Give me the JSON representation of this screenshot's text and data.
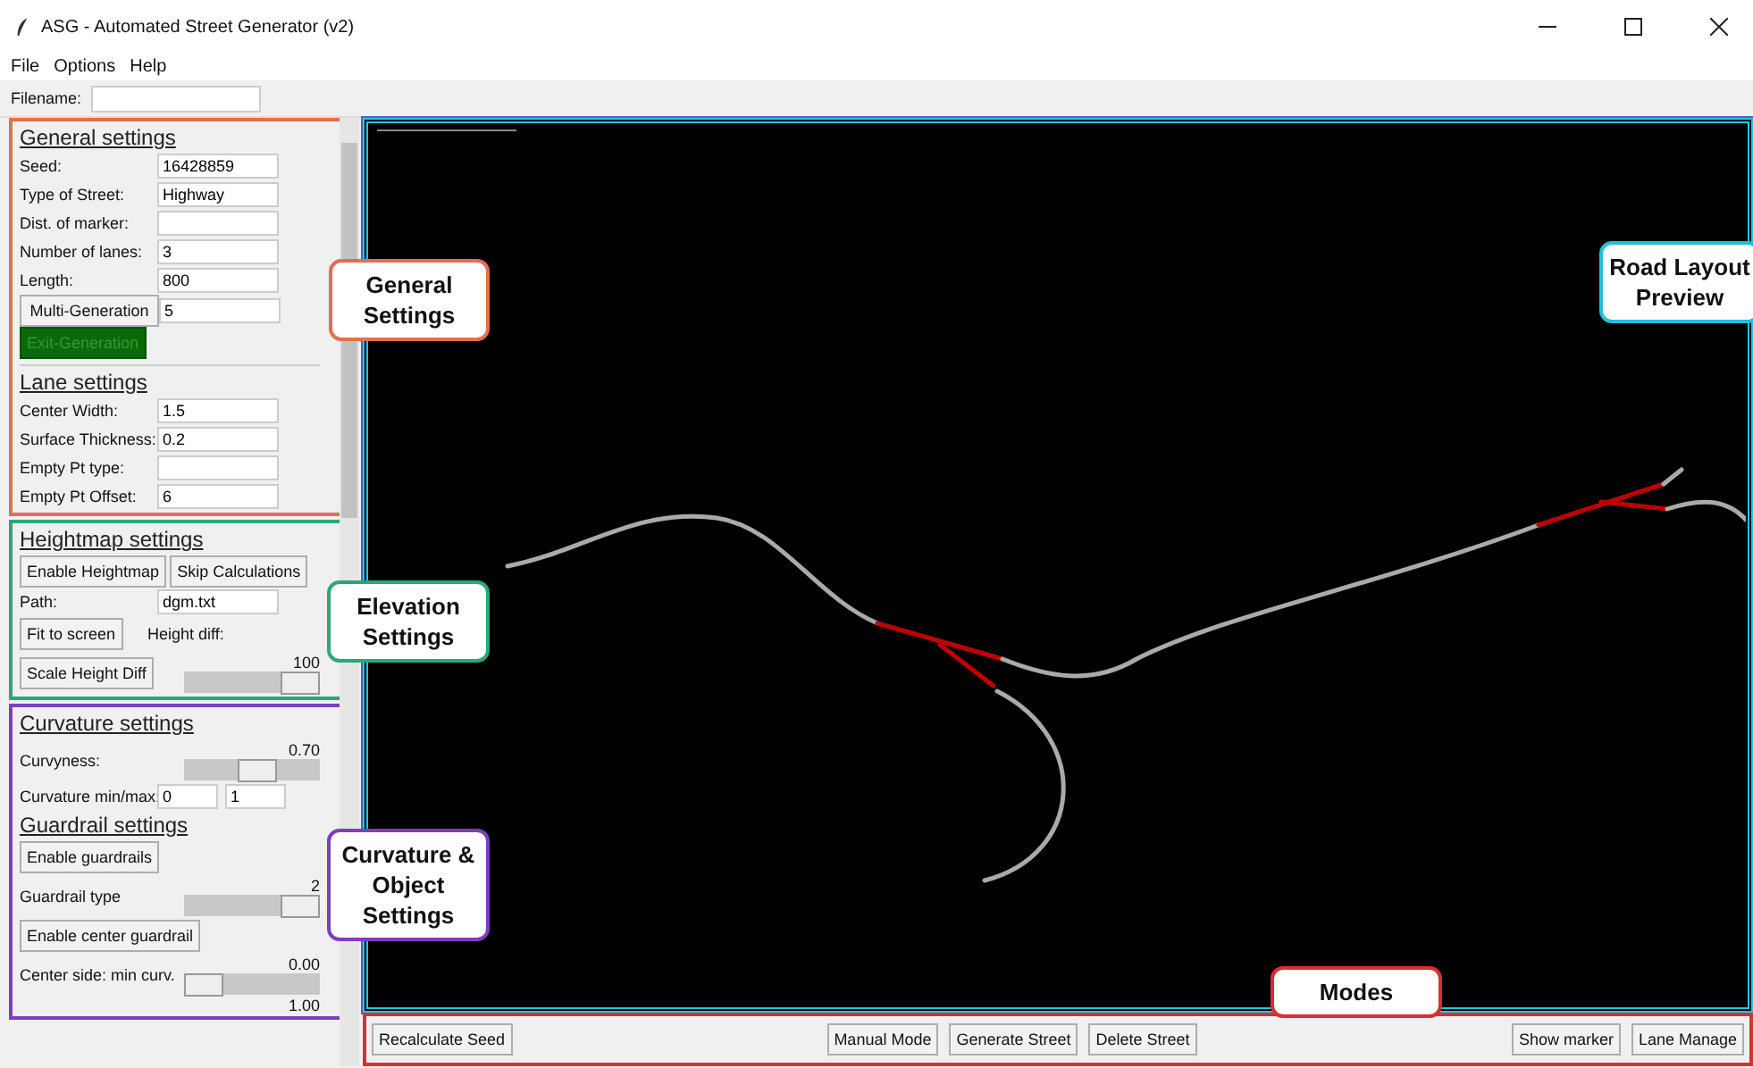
{
  "window": {
    "title": "ASG - Automated Street Generator (v2)"
  },
  "menu": [
    "File",
    "Options",
    "Help"
  ],
  "filename": {
    "label": "Filename:"
  },
  "groups": [
    {
      "color": "#e07050",
      "rows": [
        {
          "kind": "heading",
          "text": "General settings"
        },
        {
          "kind": "field",
          "label": "Seed:",
          "value": "16428859"
        },
        {
          "kind": "field",
          "label": "Type of Street:",
          "value": "Highway"
        },
        {
          "kind": "field",
          "label": "Dist. of marker:"
        },
        {
          "kind": "field",
          "label": "Number of lanes:",
          "value": "3"
        },
        {
          "kind": "field",
          "label": "Length:",
          "value": "800"
        },
        {
          "kind": "button_field",
          "label": "Multi-Generation",
          "value": "5"
        },
        {
          "kind": "toggle",
          "label": "Exit-Generation",
          "on": true
        },
        {
          "kind": "divider"
        },
        {
          "kind": "heading",
          "text": "Lane settings"
        },
        {
          "kind": "field",
          "label": "Center Width:",
          "value": "1.5"
        },
        {
          "kind": "field",
          "label": "Surface Thickness:",
          "value": "0.2"
        },
        {
          "kind": "field",
          "label": "Empty Pt type:"
        },
        {
          "kind": "field",
          "label": "Empty Pt Offset:",
          "value": "6"
        }
      ]
    },
    {
      "color": "#2aa878",
      "rows": [
        {
          "kind": "heading",
          "text": "Heightmap settings"
        },
        {
          "kind": "buttons",
          "labels": [
            "Enable Heightmap",
            "Skip Calculations"
          ]
        },
        {
          "kind": "field",
          "label": "Path:",
          "value": "dgm.txt"
        },
        {
          "kind": "button_text",
          "label": "Fit to screen",
          "text": "Height diff:"
        },
        {
          "kind": "button_slider",
          "label": "Scale Height Diff",
          "reading": "100",
          "level": 1
        }
      ]
    },
    {
      "color": "#7b3fc0",
      "rows": [
        {
          "kind": "heading",
          "text": "Curvature settings"
        },
        {
          "kind": "label_slider",
          "label": "Curvyness:",
          "reading": "0.70",
          "level": 0.55
        },
        {
          "kind": "range",
          "label": "Curvature min/max:",
          "min": "0",
          "max": "1"
        },
        {
          "kind": "heading",
          "text": "Guardrail settings"
        },
        {
          "kind": "button",
          "label": "Enable guardrails"
        },
        {
          "kind": "label_slider",
          "label": "Guardrail type",
          "reading": "2",
          "level": 1
        },
        {
          "kind": "button",
          "label": "Enable center guardrail"
        },
        {
          "kind": "label_slider",
          "label": "Center side: min curv.",
          "reading": "0.00",
          "level": 0
        },
        {
          "kind": "cut_text",
          "text": "1.00"
        }
      ]
    }
  ],
  "toolbar": {
    "left": [
      "Recalculate Seed"
    ],
    "center": [
      "Manual Mode",
      "Generate Street",
      "Delete Street"
    ],
    "right": [
      "Show marker",
      "Lane Manage"
    ]
  },
  "callouts": [
    {
      "text": "General Settings",
      "color": "#e07050"
    },
    {
      "text": "Elevation Settings",
      "color": "#2aa878"
    },
    {
      "text": "Curvature & Object Settings",
      "color": "#7b3fc0"
    },
    {
      "text": "Road Layout Preview",
      "color": "#20c0d8"
    },
    {
      "text": "Modes",
      "color": "#d83030"
    }
  ]
}
